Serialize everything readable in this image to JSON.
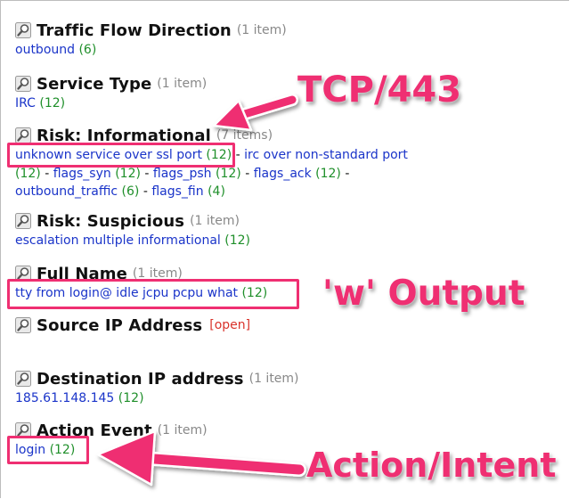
{
  "sections": {
    "traffic": {
      "title": "Traffic Flow Direction",
      "count": "(1 item)",
      "values": [
        {
          "text": "outbound",
          "num": "(6)"
        }
      ]
    },
    "service": {
      "title": "Service Type",
      "count": "(1 item)",
      "values": [
        {
          "text": "IRC",
          "num": "(12)"
        }
      ]
    },
    "riskInfo": {
      "title": "Risk: Informational",
      "count": "(7 items)",
      "values": [
        {
          "text": "unknown service over ssl port",
          "num": "(12)"
        },
        {
          "text": "irc over non-standard port",
          "num": ""
        },
        {
          "text": "",
          "num": "(12)"
        },
        {
          "text": "flags_syn",
          "num": "(12)"
        },
        {
          "text": "flags_psh",
          "num": "(12)"
        },
        {
          "text": "flags_ack",
          "num": "(12)"
        },
        {
          "text": "outbound_traffic",
          "num": "(6)"
        },
        {
          "text": "flags_fin",
          "num": "(4)"
        }
      ]
    },
    "riskSusp": {
      "title": "Risk: Suspicious",
      "count": "(1 item)",
      "values": [
        {
          "text": "escalation multiple informational",
          "num": "(12)"
        }
      ]
    },
    "fullName": {
      "title": "Full Name",
      "count": "(1 item)",
      "values": [
        {
          "text": "tty from login@ idle jcpu pcpu what",
          "num": "(12)"
        }
      ]
    },
    "srcIp": {
      "title": "Source IP Address",
      "open": "[open]"
    },
    "dstIp": {
      "title": "Destination IP address",
      "count": "(1 item)",
      "values": [
        {
          "text": "185.61.148.145",
          "num": "(12)"
        }
      ]
    },
    "action": {
      "title": "Action Event",
      "count": "(1 item)",
      "values": [
        {
          "text": "login",
          "num": "(12)"
        }
      ]
    }
  },
  "separator": "-",
  "annotations": {
    "tcp": "TCP/443",
    "w": "'w' Output",
    "action": "Action/Intent"
  },
  "colors": {
    "link": "#1a34c9",
    "count_num": "#1f8f2a",
    "annotation": "#ef2f72",
    "open": "#d9332b"
  },
  "icon": "magnifier-icon"
}
